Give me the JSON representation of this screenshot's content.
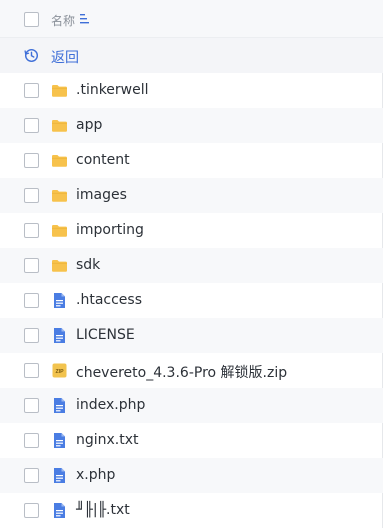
{
  "header": {
    "name_label": "名称"
  },
  "back": {
    "label": "返回"
  },
  "colors": {
    "folder": "#f7c24c",
    "file": "#4a7de3",
    "zip": "#f2c34e",
    "accent": "#3f6fd8"
  },
  "files": [
    {
      "name": ".tinkerwell",
      "type": "folder",
      "icon": "folder-icon"
    },
    {
      "name": "app",
      "type": "folder",
      "icon": "folder-icon"
    },
    {
      "name": "content",
      "type": "folder",
      "icon": "folder-icon"
    },
    {
      "name": "images",
      "type": "folder",
      "icon": "folder-icon"
    },
    {
      "name": "importing",
      "type": "folder",
      "icon": "folder-icon"
    },
    {
      "name": "sdk",
      "type": "folder",
      "icon": "folder-icon"
    },
    {
      "name": ".htaccess",
      "type": "file",
      "icon": "document-icon"
    },
    {
      "name": "LICENSE",
      "type": "file",
      "icon": "document-icon"
    },
    {
      "name": "chevereto_4.3.6-Pro 解锁版.zip",
      "type": "zip",
      "icon": "zip-icon",
      "badge": "ZIP"
    },
    {
      "name": "index.php",
      "type": "file",
      "icon": "document-icon"
    },
    {
      "name": "nginx.txt",
      "type": "file",
      "icon": "document-icon"
    },
    {
      "name": "x.php",
      "type": "file",
      "icon": "document-icon"
    },
    {
      "name": "╜╟|╟.txt",
      "type": "file",
      "icon": "document-icon"
    }
  ]
}
